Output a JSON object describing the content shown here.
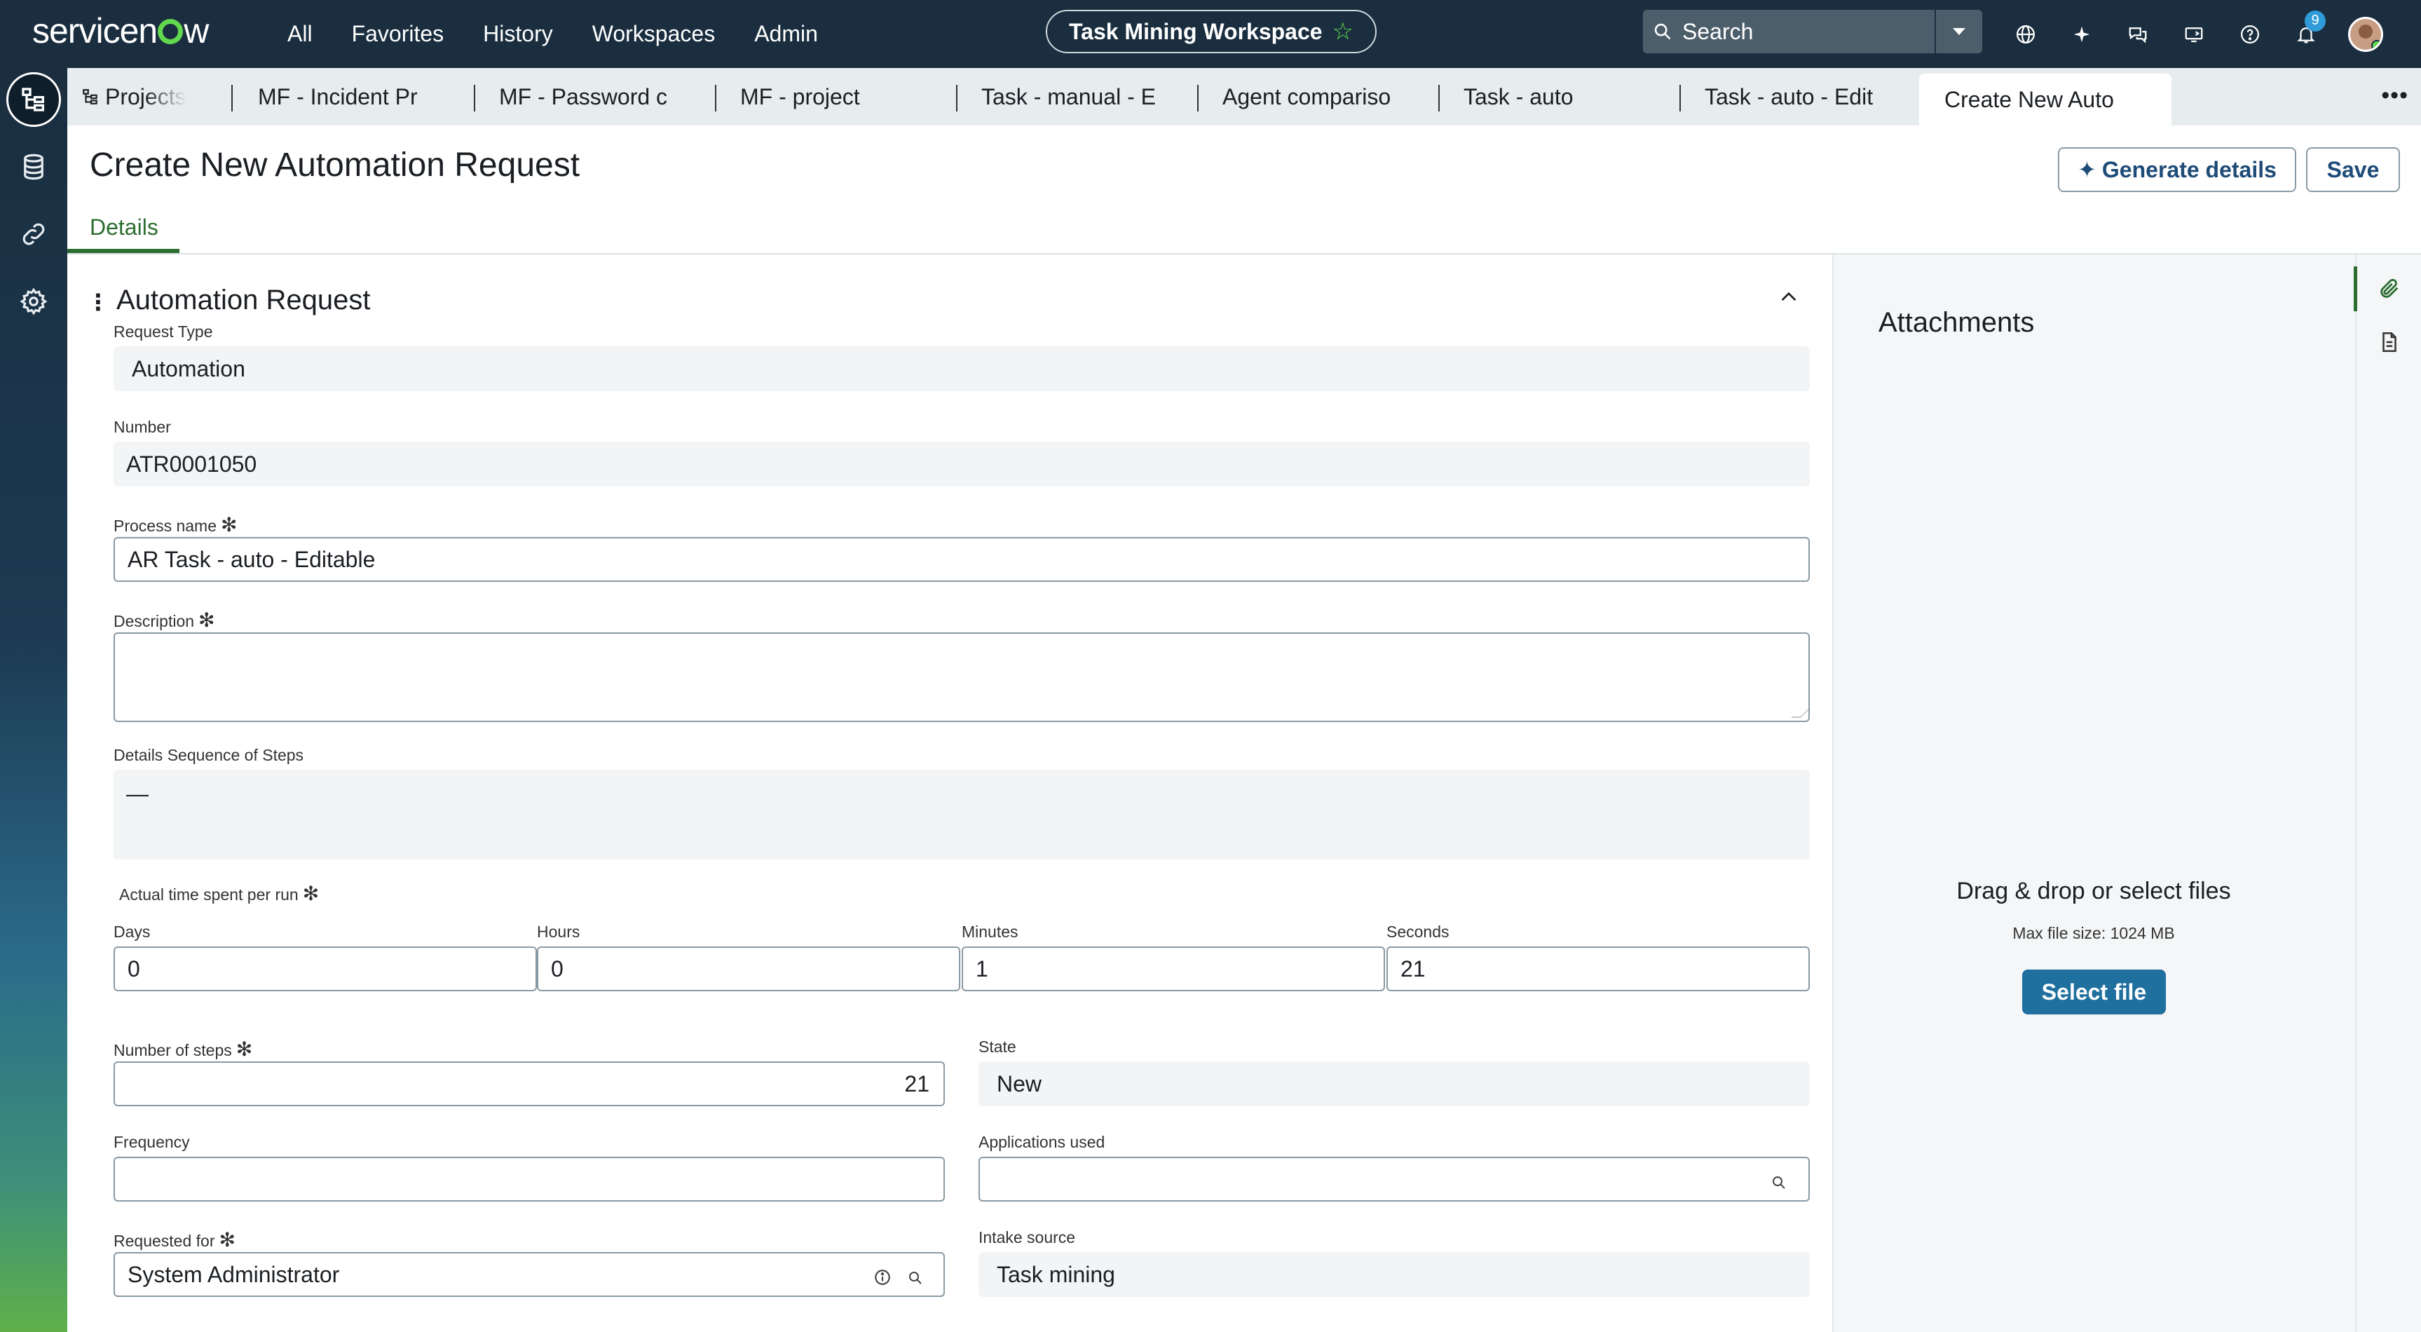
{
  "brand": {
    "logo_text_a": "servicen",
    "logo_text_b": "w"
  },
  "nav": {
    "items": [
      "All",
      "Favorites",
      "History",
      "Workspaces",
      "Admin"
    ],
    "workspace": "Task Mining Workspace",
    "search_placeholder": "Search",
    "notification_count": "9"
  },
  "tabs": [
    {
      "label": "Projects"
    },
    {
      "label": "MF - Incident Pr"
    },
    {
      "label": "MF - Password c"
    },
    {
      "label": "MF - project"
    },
    {
      "label": "Task - manual - E"
    },
    {
      "label": "Agent compariso"
    },
    {
      "label": "Task - auto"
    },
    {
      "label": "Task - auto - Edit"
    },
    {
      "label": "Create New Auto"
    }
  ],
  "page": {
    "title": "Create New Automation Request",
    "generate_label": "Generate details",
    "save_label": "Save",
    "details_tab": "Details"
  },
  "form": {
    "section_title": "Automation Request",
    "request_type": {
      "label": "Request Type",
      "value": "Automation"
    },
    "number": {
      "label": "Number",
      "value": "ATR0001050"
    },
    "process_name": {
      "label": "Process name",
      "value": "AR Task - auto - Editable"
    },
    "description": {
      "label": "Description",
      "value": ""
    },
    "details_sequence": {
      "label": "Details Sequence of Steps",
      "value": "—"
    },
    "time_spent": {
      "label": "Actual time spent per run"
    },
    "days": {
      "label": "Days",
      "value": "0"
    },
    "hours": {
      "label": "Hours",
      "value": "0"
    },
    "minutes": {
      "label": "Minutes",
      "value": "1"
    },
    "seconds": {
      "label": "Seconds",
      "value": "21"
    },
    "num_steps": {
      "label": "Number of steps",
      "value": "21"
    },
    "state": {
      "label": "State",
      "value": "New"
    },
    "frequency": {
      "label": "Frequency",
      "value": ""
    },
    "applications": {
      "label": "Applications used",
      "value": ""
    },
    "requested_for": {
      "label": "Requested for",
      "value": "System Administrator"
    },
    "intake_source": {
      "label": "Intake source",
      "value": "Task mining"
    },
    "required_mark": "✻"
  },
  "attachments": {
    "title": "Attachments",
    "drop_text": "Drag & drop or select files",
    "max_size": "Max file size: 1024 MB",
    "select_label": "Select file"
  },
  "colors": {
    "nav_bg": "#1a2e3f",
    "accent_green": "#62d84e",
    "primary_button": "#1f6f9f",
    "tab_active_green": "#2c6e2f"
  }
}
